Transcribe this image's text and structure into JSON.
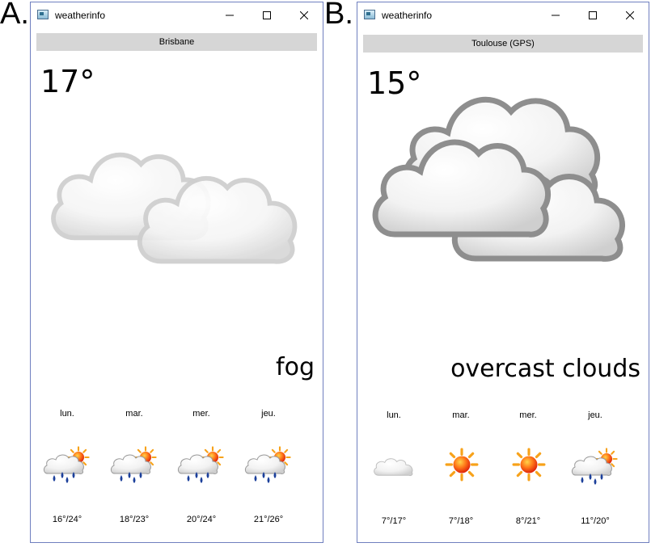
{
  "panels": [
    {
      "label": "A.",
      "window_title": "weatherinfo",
      "city": "Brisbane",
      "temperature": "17°",
      "condition": "fog",
      "big_icon": "fog-clouds-icon",
      "forecast": [
        {
          "day": "lun.",
          "icon": "rain-sun-icon",
          "range": "16°/24°"
        },
        {
          "day": "mar.",
          "icon": "rain-sun-icon",
          "range": "18°/23°"
        },
        {
          "day": "mer.",
          "icon": "rain-sun-icon",
          "range": "20°/24°"
        },
        {
          "day": "jeu.",
          "icon": "rain-sun-icon",
          "range": "21°/26°"
        }
      ]
    },
    {
      "label": "B.",
      "window_title": "weatherinfo",
      "city": "Toulouse (GPS)",
      "temperature": "15°",
      "condition": "overcast clouds",
      "big_icon": "overcast-clouds-icon",
      "forecast": [
        {
          "day": "lun.",
          "icon": "cloud-icon",
          "range": "7°/17°"
        },
        {
          "day": "mar.",
          "icon": "sun-icon",
          "range": "7°/18°"
        },
        {
          "day": "mer.",
          "icon": "sun-icon",
          "range": "8°/21°"
        },
        {
          "day": "jeu.",
          "icon": "rain-sun-icon",
          "range": "11°/20°"
        }
      ]
    }
  ],
  "colors": {
    "citybar": "#d6d6d6",
    "window_border": "#6f7fbf",
    "rain_drop": "#1b3f9a",
    "sun": "#f05a1a"
  }
}
